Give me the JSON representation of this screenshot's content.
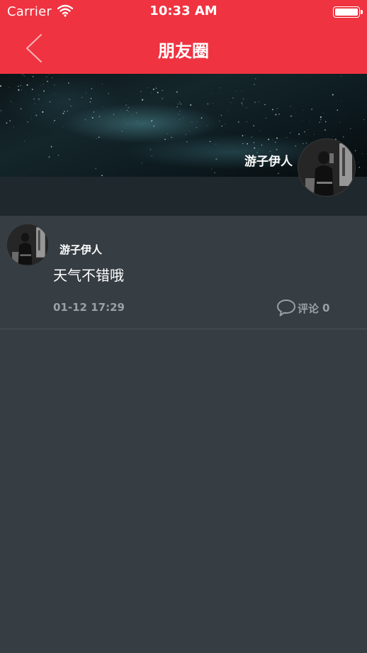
{
  "status_bar": {
    "carrier": "Carrier",
    "time": "10:33 AM",
    "icons": [
      "wifi-icon",
      "battery-icon"
    ]
  },
  "nav": {
    "title": "朋友圈",
    "back_icon": "chevron-left-icon"
  },
  "profile": {
    "username": "游子伊人"
  },
  "posts": [
    {
      "username": "游子伊人",
      "content": "天气不错哦",
      "time": "01-12 17:29",
      "comment_label": "评论",
      "comment_count": "0"
    }
  ],
  "colors": {
    "accent": "#ef3340",
    "background": "#363d43",
    "muted_text": "#9aa0a4"
  }
}
